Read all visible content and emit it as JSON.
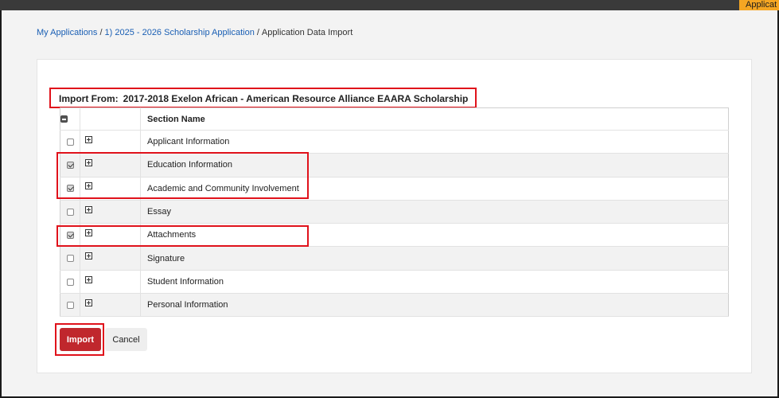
{
  "top_tab": {
    "label": "Applicat"
  },
  "breadcrumb": {
    "items": [
      "My Applications",
      "1) 2025 - 2026 Scholarship Application",
      "Application Data Import"
    ],
    "separator": "/"
  },
  "import_from": {
    "label": "Import From:",
    "value": "2017-2018 Exelon African - American Resource Alliance EAARA Scholarship"
  },
  "table": {
    "header": {
      "name": "Section Name"
    },
    "rows": [
      {
        "name": "Applicant Information",
        "checked": false
      },
      {
        "name": "Education Information",
        "checked": true
      },
      {
        "name": "Academic and Community Involvement",
        "checked": true
      },
      {
        "name": "Essay",
        "checked": false
      },
      {
        "name": "Attachments",
        "checked": true
      },
      {
        "name": "Signature",
        "checked": false
      },
      {
        "name": "Student Information",
        "checked": false
      },
      {
        "name": "Personal Information",
        "checked": false
      }
    ]
  },
  "buttons": {
    "import_label": "Import",
    "cancel_label": "Cancel"
  },
  "colors": {
    "accent": "#c0272d",
    "highlight": "#e0121b",
    "link": "#1a5fb4",
    "top_tab": "#f5a623"
  }
}
